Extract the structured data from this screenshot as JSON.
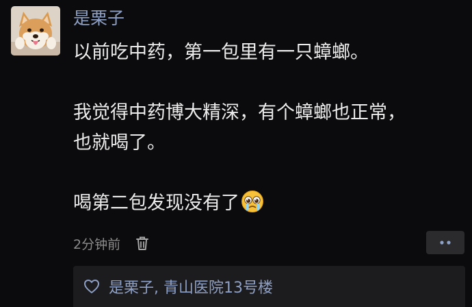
{
  "post": {
    "username": "是栗子",
    "paragraphs": [
      "以前吃中药，第一包里有一只蟑螂。",
      "我觉得中药博大精深，有个蟑螂也正常，",
      "也就喝了。",
      "喝第二包发现没有了"
    ],
    "avatar_icon": "shiba-dog-avatar",
    "emoji_icon": "crying-face-emoji",
    "timestamp": "2分钟前",
    "delete_icon": "trash-icon",
    "more_icon": "more-dots-icon"
  },
  "likes": {
    "icon": "heart-outline-icon",
    "names": "是栗子, 青山医院13号楼"
  },
  "colors": {
    "background": "#0b0b0d",
    "name_link": "#8ea0c6",
    "body_text": "#ededed",
    "meta_text": "#8c8c8c",
    "likes_bar": "#1c1c1f",
    "more_button": "#2b2b2e"
  }
}
